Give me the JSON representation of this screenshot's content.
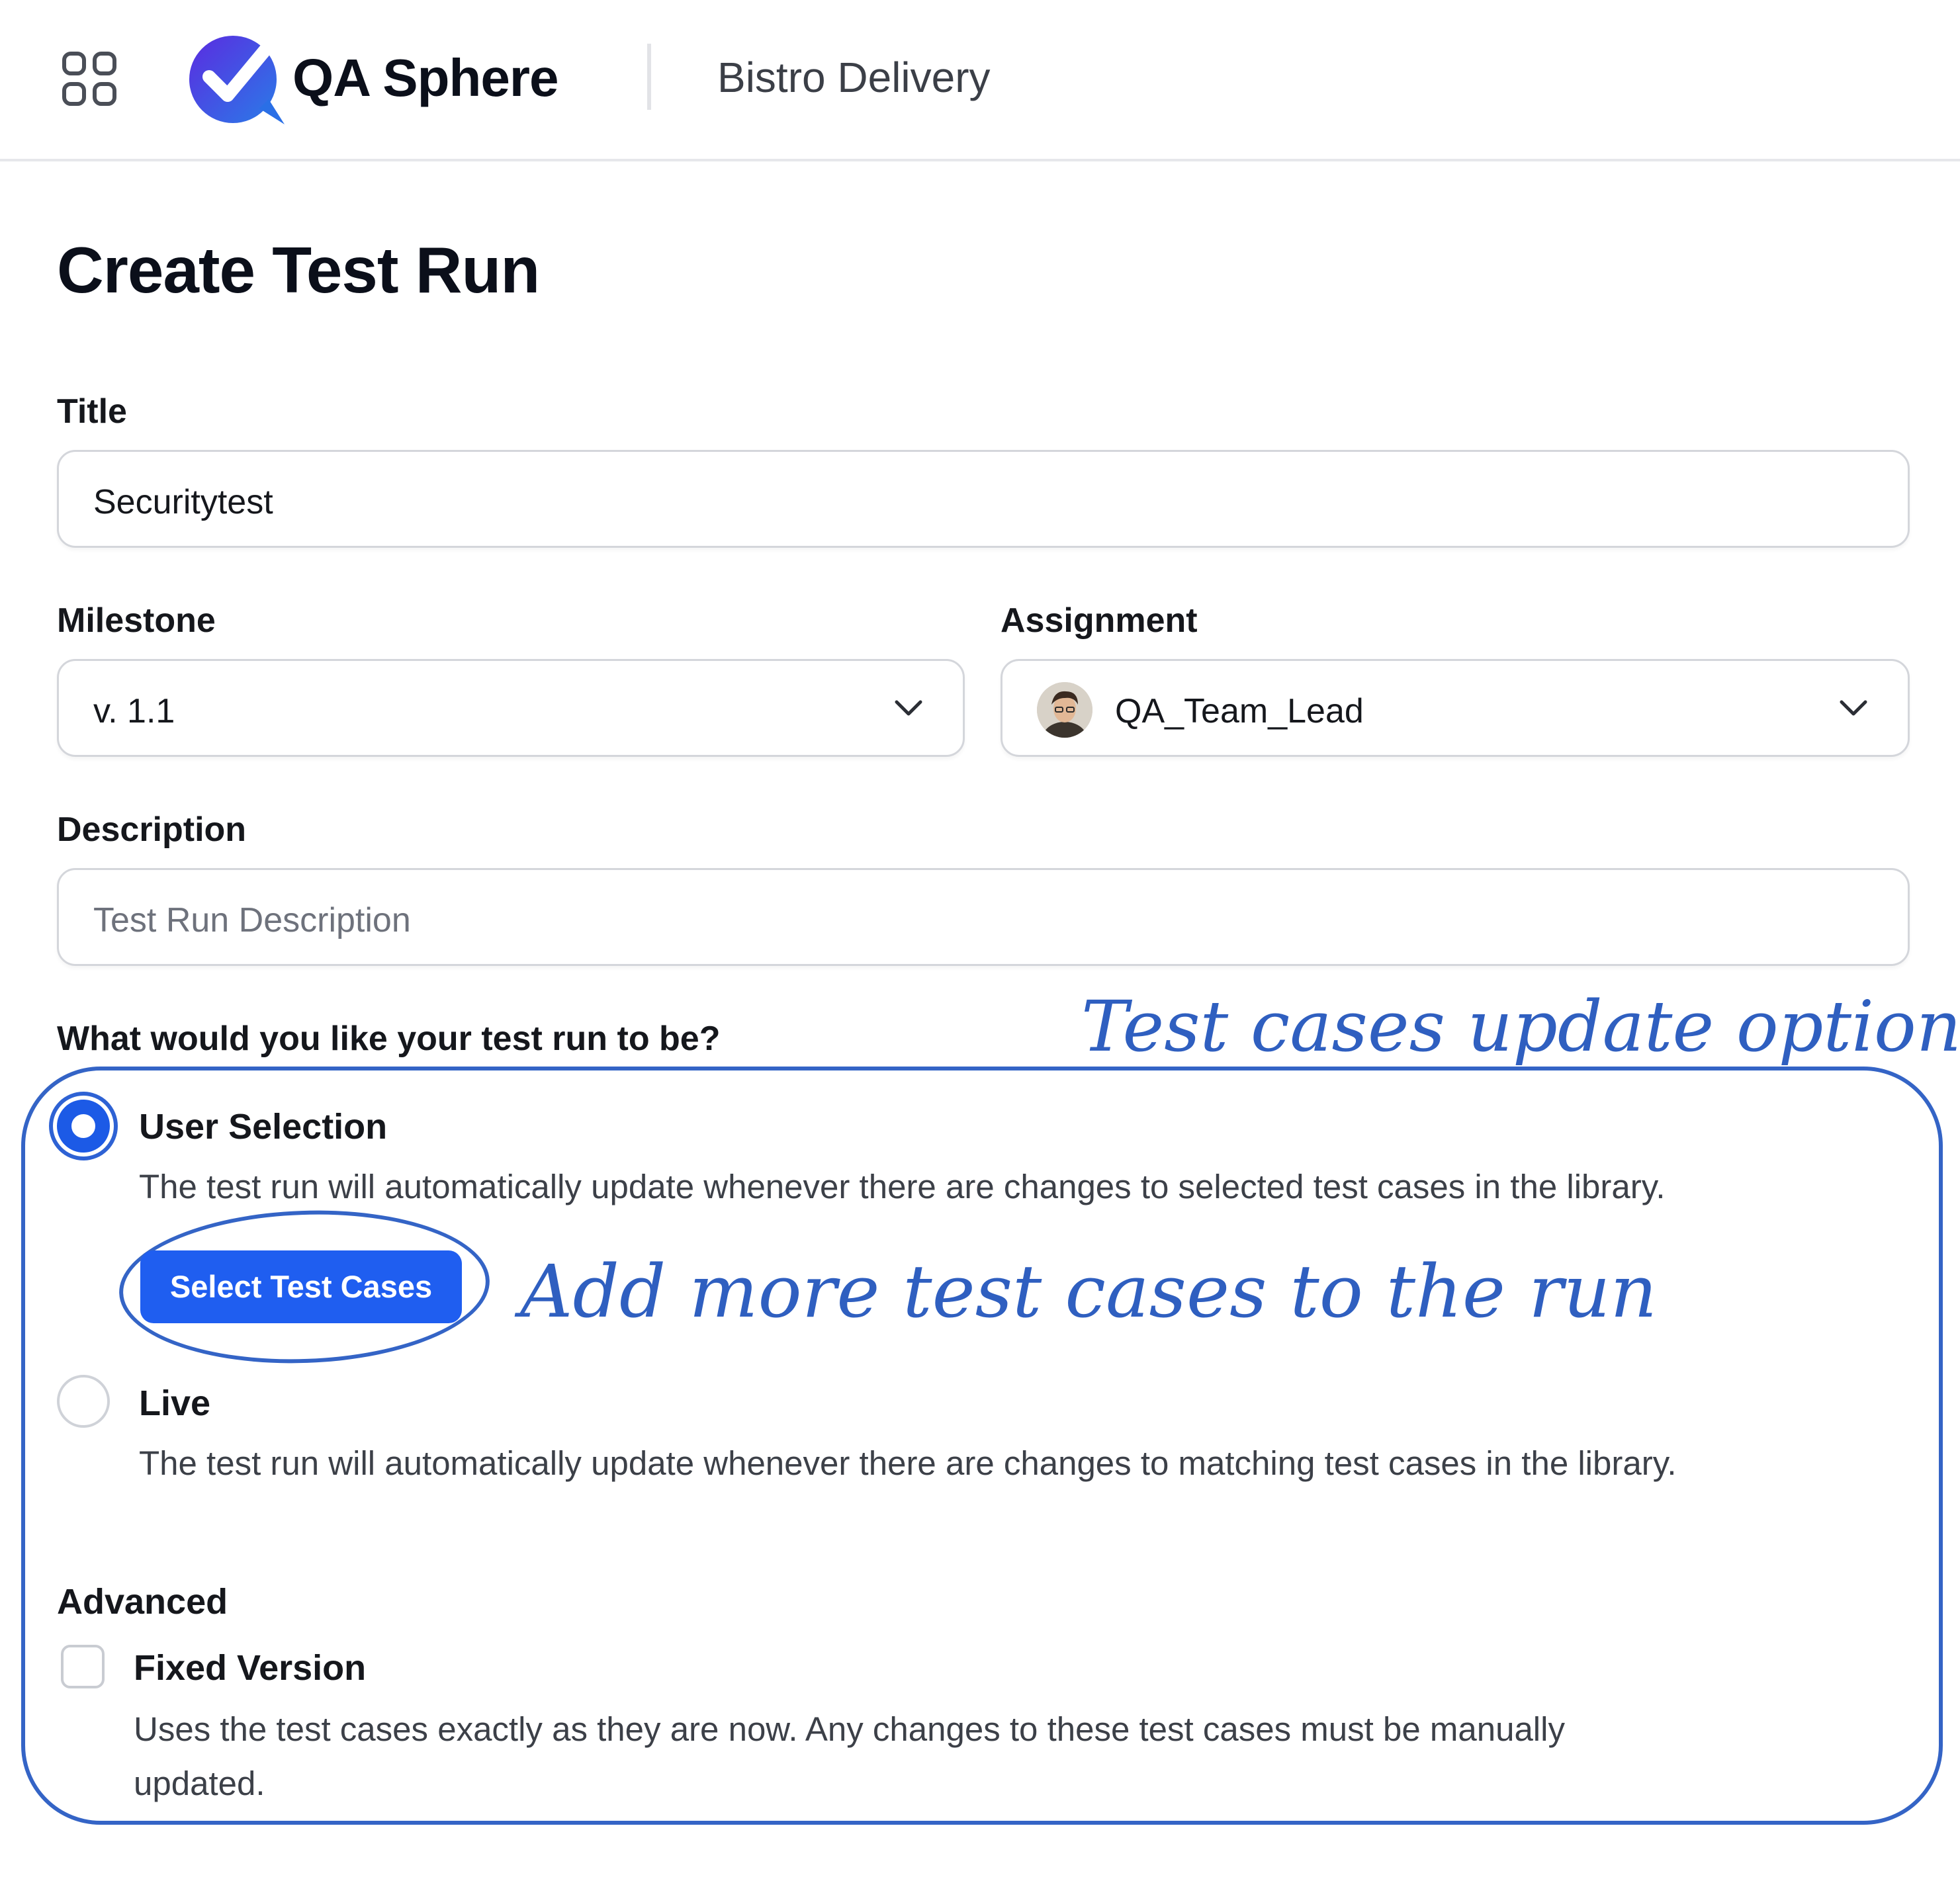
{
  "header": {
    "app_name": "QA Sphere",
    "project_name": "Bistro Delivery",
    "apps_icon": "grid-icon",
    "brand_color": "#2f4fe0"
  },
  "form": {
    "page_title": "Create Test Run",
    "title_label": "Title",
    "title_value": "Securitytest",
    "milestone_label": "Milestone",
    "milestone_value": "v. 1.1",
    "assignment_label": "Assignment",
    "assignment_value": "QA_Team_Lead",
    "description_label": "Description",
    "description_placeholder": "Test Run Description",
    "question": "What would you like your test run to be?",
    "options": [
      {
        "label": "User Selection",
        "description": "The test run will automatically update whenever there are changes to selected test cases in the library.",
        "selected": true
      },
      {
        "label": "Live",
        "description": "The test run will automatically update whenever there are changes to matching test cases in the library.",
        "selected": false
      }
    ],
    "select_button_label": "Select Test Cases",
    "advanced_label": "Advanced",
    "fixed_version_label": "Fixed Version",
    "fixed_version_description_line1": "Uses the test cases exactly as they are now. Any changes to these test cases must be manually",
    "fixed_version_description_line2": "updated.",
    "fixed_version_checked": false
  },
  "annotations": {
    "options_note": "Test cases update options",
    "button_note": "Add more test cases to the run",
    "color": "#2f5fc0"
  },
  "colors": {
    "primary_button": "#1f5ef0",
    "text": "#15171c",
    "border": "#d4d6db"
  }
}
